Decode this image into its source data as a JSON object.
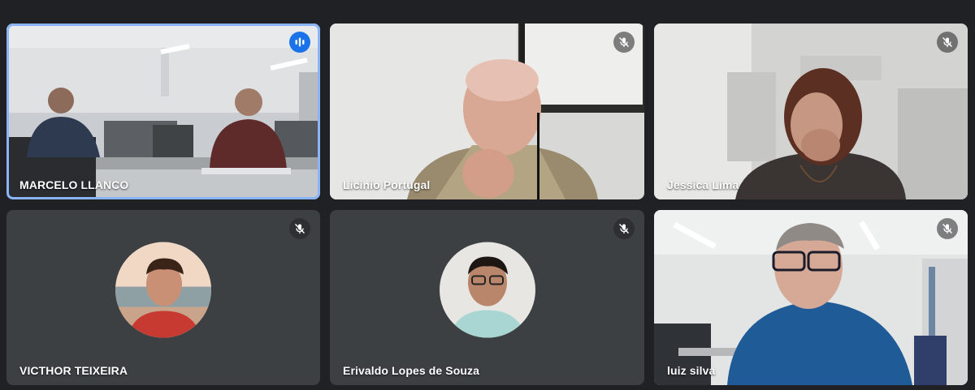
{
  "participants": [
    {
      "name": "MARCELO LLANCO",
      "status": "speaking",
      "icon": "voice-activity-icon",
      "video": "on"
    },
    {
      "name": "Licinio Portugal",
      "status": "muted",
      "icon": "mic-off-icon",
      "video": "on"
    },
    {
      "name": "Jessica Lima",
      "status": "muted",
      "icon": "mic-off-icon",
      "video": "on"
    },
    {
      "name": "VICTHOR TEIXEIRA",
      "status": "muted",
      "icon": "mic-off-icon",
      "video": "off"
    },
    {
      "name": "Erivaldo Lopes de Souza",
      "status": "muted",
      "icon": "mic-off-icon",
      "video": "off"
    },
    {
      "name": "luiz silva",
      "status": "muted",
      "icon": "mic-off-icon",
      "video": "on"
    }
  ],
  "colors": {
    "background": "#202124",
    "tile": "#3c4043",
    "active_border": "#8ab4f8",
    "speaking_badge": "#1a73e8"
  }
}
